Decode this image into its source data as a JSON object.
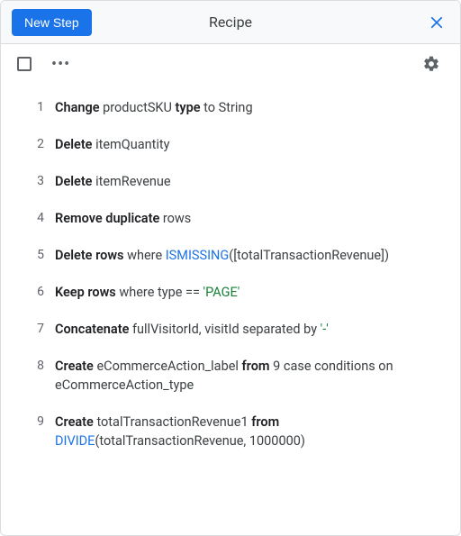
{
  "header": {
    "title": "Recipe",
    "new_step_label": "New Step"
  },
  "steps": [
    {
      "n": 1,
      "tokens": [
        {
          "t": "Change ",
          "s": "bold"
        },
        {
          "t": "productSKU ",
          "s": ""
        },
        {
          "t": "type ",
          "s": "bold"
        },
        {
          "t": "to String",
          "s": ""
        }
      ]
    },
    {
      "n": 2,
      "tokens": [
        {
          "t": "Delete ",
          "s": "bold"
        },
        {
          "t": "itemQuantity",
          "s": ""
        }
      ]
    },
    {
      "n": 3,
      "tokens": [
        {
          "t": "Delete ",
          "s": "bold"
        },
        {
          "t": "itemRevenue",
          "s": ""
        }
      ]
    },
    {
      "n": 4,
      "tokens": [
        {
          "t": "Remove duplicate ",
          "s": "bold"
        },
        {
          "t": "rows",
          "s": ""
        }
      ]
    },
    {
      "n": 5,
      "tokens": [
        {
          "t": "Delete rows ",
          "s": "bold"
        },
        {
          "t": "where ",
          "s": ""
        },
        {
          "t": "ISMISSING",
          "s": "fn"
        },
        {
          "t": "([totalTransactionRevenue])",
          "s": ""
        }
      ]
    },
    {
      "n": 6,
      "tokens": [
        {
          "t": "Keep rows ",
          "s": "bold"
        },
        {
          "t": "where type == ",
          "s": ""
        },
        {
          "t": "'PAGE'",
          "s": "str"
        }
      ]
    },
    {
      "n": 7,
      "tokens": [
        {
          "t": "Concatenate ",
          "s": "bold"
        },
        {
          "t": "fullVisitorId, visitId separated by ",
          "s": ""
        },
        {
          "t": "'-'",
          "s": "str"
        }
      ]
    },
    {
      "n": 8,
      "tokens": [
        {
          "t": "Create ",
          "s": "bold"
        },
        {
          "t": "eCommerceAction_label ",
          "s": ""
        },
        {
          "t": "from ",
          "s": "bold"
        },
        {
          "t": "9 case conditions on eCommerceAction_type",
          "s": ""
        }
      ]
    },
    {
      "n": 9,
      "tokens": [
        {
          "t": "Create ",
          "s": "bold"
        },
        {
          "t": "totalTransactionRevenue1 ",
          "s": ""
        },
        {
          "t": "from ",
          "s": "bold"
        },
        {
          "t": "DIVIDE",
          "s": "fn"
        },
        {
          "t": "(totalTransactionRevenue, 1000000)",
          "s": ""
        }
      ]
    }
  ]
}
